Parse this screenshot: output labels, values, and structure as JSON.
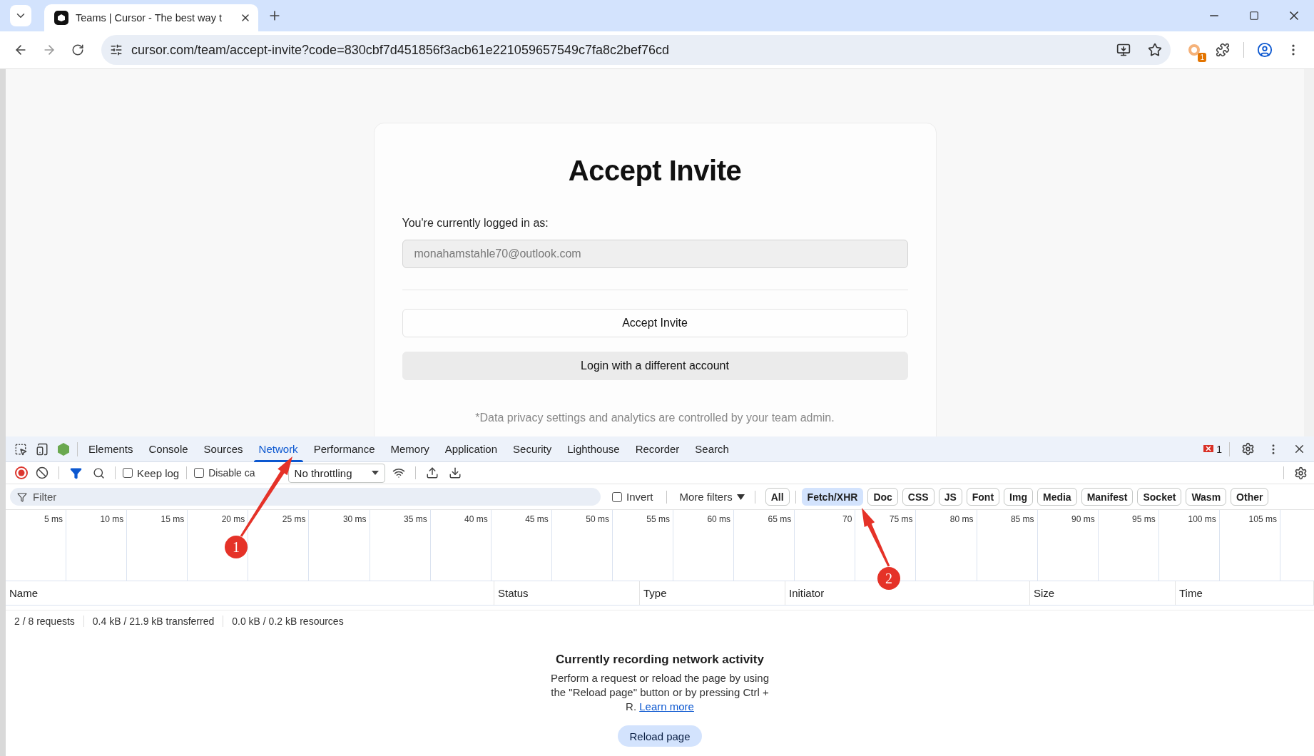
{
  "browser": {
    "tab_title": "Teams | Cursor - The best way t",
    "url": "cursor.com/team/accept-invite?code=830cbf7d451856f3acb61e221059657549c7fa8c2bef76cd",
    "extension_badge": "1"
  },
  "page": {
    "title": "Accept Invite",
    "label": "You're currently logged in as:",
    "email": "monahamstahle70@outlook.com",
    "buttons": [
      {
        "label": "Accept Invite",
        "kind": "outline"
      },
      {
        "label": "Login with a different account",
        "kind": "filled"
      }
    ],
    "footnote": "*Data privacy settings and analytics are controlled by your team admin."
  },
  "devtools": {
    "tabs": [
      {
        "label": "Elements",
        "selected": false
      },
      {
        "label": "Console",
        "selected": false
      },
      {
        "label": "Sources",
        "selected": false
      },
      {
        "label": "Network",
        "selected": true
      },
      {
        "label": "Performance",
        "selected": false
      },
      {
        "label": "Memory",
        "selected": false
      },
      {
        "label": "Application",
        "selected": false
      },
      {
        "label": "Security",
        "selected": false
      },
      {
        "label": "Lighthouse",
        "selected": false
      },
      {
        "label": "Recorder",
        "selected": false
      },
      {
        "label": "Search",
        "selected": false
      }
    ],
    "issues_count": "1",
    "toolbar": {
      "recording": true,
      "keep_log": {
        "label": "Keep log",
        "checked": false
      },
      "disable_cache": {
        "label": "Disable ca",
        "checked": false
      },
      "throttling": "No throttling"
    },
    "filter": {
      "placeholder": "Filter",
      "invert": {
        "label": "Invert",
        "checked": false
      },
      "more_filters": "More filters",
      "types": [
        {
          "label": "All",
          "selected": false
        },
        {
          "label": "Fetch/XHR",
          "selected": true
        },
        {
          "label": "Doc",
          "selected": false
        },
        {
          "label": "CSS",
          "selected": false
        },
        {
          "label": "JS",
          "selected": false
        },
        {
          "label": "Font",
          "selected": false
        },
        {
          "label": "Img",
          "selected": false
        },
        {
          "label": "Media",
          "selected": false
        },
        {
          "label": "Manifest",
          "selected": false
        },
        {
          "label": "Socket",
          "selected": false
        },
        {
          "label": "Wasm",
          "selected": false
        },
        {
          "label": "Other",
          "selected": false
        }
      ]
    },
    "timeline_ticks": [
      "5 ms",
      "10 ms",
      "15 ms",
      "20 ms",
      "25 ms",
      "30 ms",
      "35 ms",
      "40 ms",
      "45 ms",
      "50 ms",
      "55 ms",
      "60 ms",
      "65 ms",
      "70",
      "75 ms",
      "80 ms",
      "85 ms",
      "90 ms",
      "95 ms",
      "100 ms",
      "105 ms"
    ],
    "columns": [
      "Name",
      "Status",
      "Type",
      "Initiator",
      "Size",
      "Time"
    ],
    "summary": [
      "2 / 8 requests",
      "0.4 kB / 21.9 kB transferred",
      "0.0 kB / 0.2 kB resources"
    ],
    "empty_state": {
      "title": "Currently recording network activity",
      "text": "Perform a request or reload the page by using the \"Reload page\" button or by pressing Ctrl + R.",
      "link": "Learn more",
      "button": "Reload page"
    }
  },
  "annotations": [
    {
      "number": "1"
    },
    {
      "number": "2"
    }
  ]
}
